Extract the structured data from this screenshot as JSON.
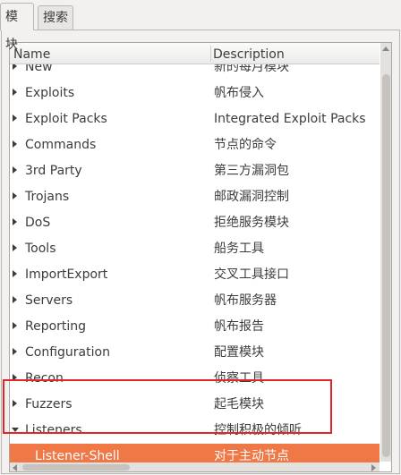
{
  "tabs": [
    {
      "label": "模块",
      "active": true
    },
    {
      "label": "搜索",
      "active": false
    }
  ],
  "columns": {
    "name": "Name",
    "description": "Description"
  },
  "rows": [
    {
      "name": "New",
      "description": "新的每月模块",
      "expander": "collapsed",
      "partial": true
    },
    {
      "name": "Exploits",
      "description": "帆布侵入",
      "expander": "collapsed"
    },
    {
      "name": "Exploit Packs",
      "description": "Integrated Exploit Packs",
      "expander": "collapsed"
    },
    {
      "name": "Commands",
      "description": "节点的命令",
      "expander": "collapsed"
    },
    {
      "name": "3rd Party",
      "description": "第三方漏洞包",
      "expander": "collapsed"
    },
    {
      "name": "Trojans",
      "description": "邮政漏洞控制",
      "expander": "collapsed"
    },
    {
      "name": "DoS",
      "description": "拒绝服务模块",
      "expander": "collapsed"
    },
    {
      "name": "Tools",
      "description": "船务工具",
      "expander": "collapsed"
    },
    {
      "name": "ImportExport",
      "description": "交叉工具接口",
      "expander": "collapsed"
    },
    {
      "name": "Servers",
      "description": "帆布服务器",
      "expander": "collapsed"
    },
    {
      "name": "Reporting",
      "description": "帆布报告",
      "expander": "collapsed"
    },
    {
      "name": "Configuration",
      "description": "配置模块",
      "expander": "collapsed"
    },
    {
      "name": "Recon",
      "description": "侦察工具",
      "expander": "collapsed"
    },
    {
      "name": "Fuzzers",
      "description": "起毛模块",
      "expander": "collapsed"
    },
    {
      "name": "Listeners",
      "description": "控制积极的倾听",
      "expander": "expanded"
    },
    {
      "name": "Listener-Shell",
      "description": "对于主动节点",
      "expander": "none",
      "selected": true
    }
  ],
  "colors": {
    "selection": "#f07746",
    "highlight_box": "#e0252b"
  }
}
